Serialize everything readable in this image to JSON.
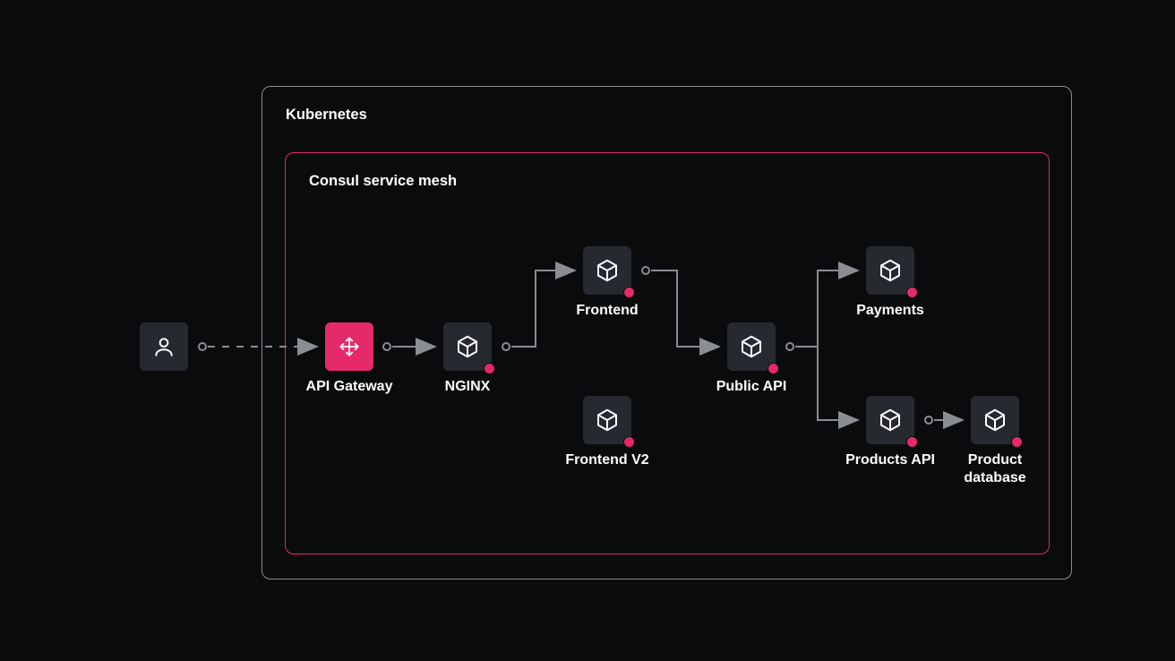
{
  "containers": {
    "kubernetes": {
      "label": "Kubernetes"
    },
    "consul": {
      "label": "Consul service mesh"
    }
  },
  "nodes": {
    "user": {
      "label": ""
    },
    "api_gateway": {
      "label": "API Gateway"
    },
    "nginx": {
      "label": "NGINX"
    },
    "frontend": {
      "label": "Frontend"
    },
    "frontend_v2": {
      "label": "Frontend V2"
    },
    "public_api": {
      "label": "Public API"
    },
    "payments": {
      "label": "Payments"
    },
    "products_api": {
      "label": "Products API"
    },
    "product_database": {
      "label": "Product database"
    }
  },
  "colors": {
    "accent": "#e5296b",
    "node_bg": "#272930",
    "line": "#8a8d93",
    "bg": "#0a0b0d"
  },
  "diagram": {
    "description": "Architecture diagram showing a user connecting through an API Gateway into a Consul service mesh running inside Kubernetes. Traffic flows: user → API Gateway → NGINX → Frontend → Public API → (Payments, Products API → Product database). Frontend V2 is shown as an additional service.",
    "edges": [
      {
        "from": "user",
        "to": "api_gateway",
        "style": "dashed"
      },
      {
        "from": "api_gateway",
        "to": "nginx",
        "style": "solid"
      },
      {
        "from": "nginx",
        "to": "frontend",
        "style": "solid"
      },
      {
        "from": "frontend",
        "to": "public_api",
        "style": "solid"
      },
      {
        "from": "public_api",
        "to": "payments",
        "style": "solid"
      },
      {
        "from": "public_api",
        "to": "products_api",
        "style": "solid"
      },
      {
        "from": "products_api",
        "to": "product_database",
        "style": "solid"
      }
    ]
  }
}
